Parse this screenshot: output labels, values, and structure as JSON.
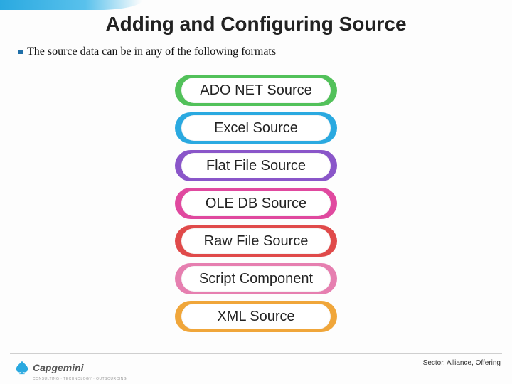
{
  "title": "Adding and Configuring Source",
  "bullet_text": "The source data can be in any of the following formats",
  "pills": [
    {
      "label": "ADO NET Source",
      "color": "#52c15a"
    },
    {
      "label": "Excel Source",
      "color": "#2aa9e0"
    },
    {
      "label": "Flat File Source",
      "color": "#8a56c9"
    },
    {
      "label": "OLE DB Source",
      "color": "#e0499f"
    },
    {
      "label": "Raw File Source",
      "color": "#e04a4a"
    },
    {
      "label": "Script Component",
      "color": "#e67fb0"
    },
    {
      "label": "XML Source",
      "color": "#f0a63a"
    }
  ],
  "footer": {
    "brand": "Capgemini",
    "tagline": "CONSULTING · TECHNOLOGY · OUTSOURCING",
    "right": "| Sector, Alliance, Offering"
  }
}
